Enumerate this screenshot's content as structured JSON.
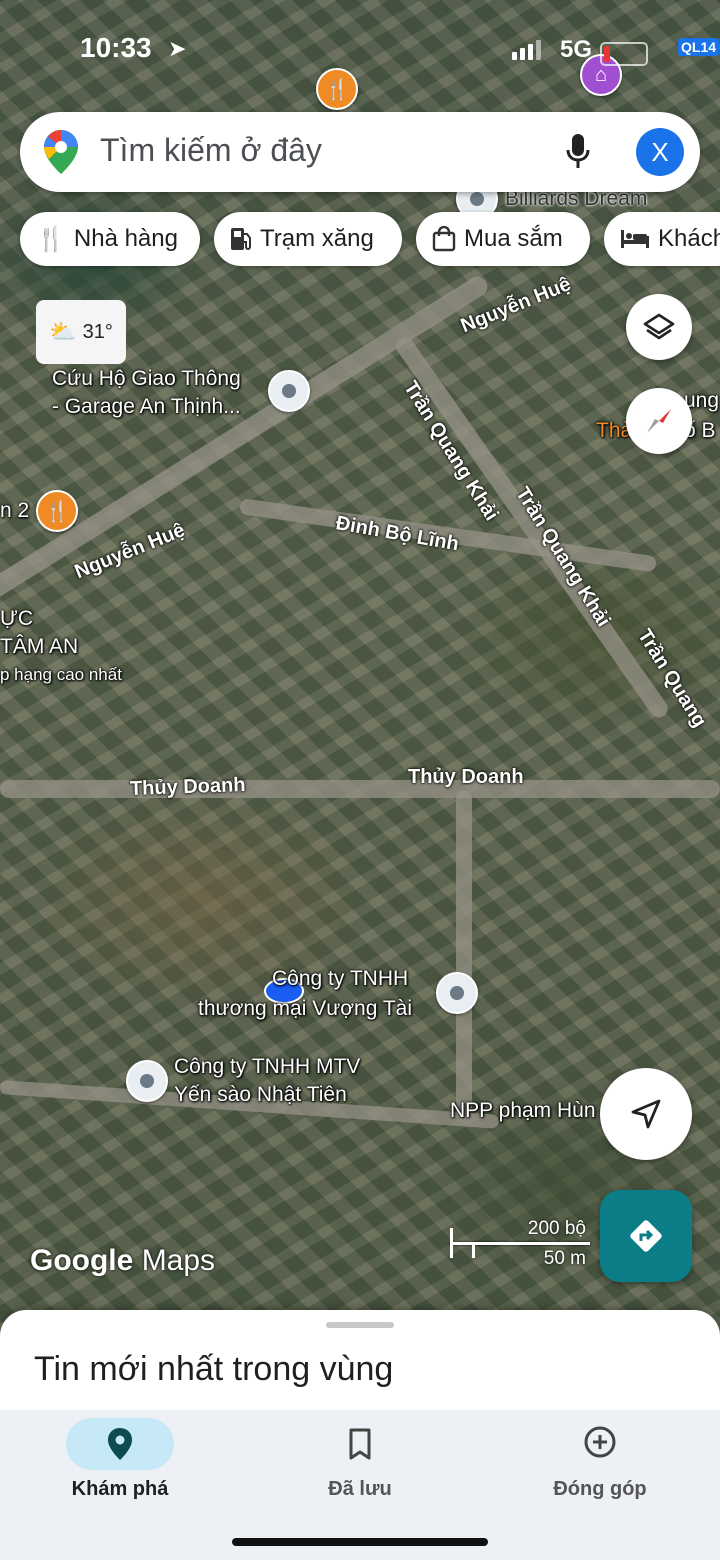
{
  "status_bar": {
    "time": "10:33",
    "network": "5G",
    "route_badge": "QL14"
  },
  "search": {
    "placeholder": "Tìm kiếm ở đây",
    "avatar_letter": "X"
  },
  "chips": [
    {
      "label": "Nhà hàng",
      "icon": "restaurant-icon"
    },
    {
      "label": "Trạm xăng",
      "icon": "gas-station-icon"
    },
    {
      "label": "Mua sắm",
      "icon": "shopping-bag-icon"
    },
    {
      "label": "Khách",
      "icon": "hotel-bed-icon"
    }
  ],
  "weather": {
    "temp": "31°",
    "icon": "partly-cloudy-icon"
  },
  "map": {
    "roads": {
      "nguyen_hue_1": "Nguyễn Huệ",
      "nguyen_hue_2": "Nguyễn Huệ",
      "tran_quang_khai_1": "Trần Quang Khải",
      "tran_quang_khai_2": "Trần Quang Khải",
      "tran_quang_3": "Trần Quang",
      "dinh_bo_linh": "Đinh Bộ Lĩnh",
      "thuy_doanh_1": "Thủy Doanh",
      "thuy_doanh_2": "Thủy Doanh"
    },
    "places": {
      "billiards": "Billiards Dream",
      "garage_line1": "Cứu Hộ Giao Thông",
      "garage_line2": "- Garage An Thịnh...",
      "left_edge_1": "n 2",
      "tam_an_line1": "ỰC",
      "tam_an_line2": "TÂM AN",
      "tam_an_line3": "p hạng cao nhất",
      "right_edge_1": "ung",
      "right_edge_2": "Thà",
      "right_edge_3": "ố B",
      "vuong_tai_line1": "Công ty TNHH",
      "vuong_tai_line2": "thương mại Vượng Tài",
      "nhat_tien_line1": "Công ty TNHH MTV",
      "nhat_tien_line2": "Yến sào Nhật Tiên",
      "npp": "NPP phạm Hùn"
    },
    "scale": {
      "imperial": "200 bộ",
      "metric": "50 m"
    },
    "logo": {
      "google": "Google",
      "maps": "Maps"
    }
  },
  "sheet": {
    "title": "Tin mới nhất trong vùng"
  },
  "nav": [
    {
      "label": "Khám phá",
      "icon": "explore-pin-icon",
      "active": true
    },
    {
      "label": "Đã lưu",
      "icon": "bookmark-icon",
      "active": false
    },
    {
      "label": "Đóng góp",
      "icon": "add-circle-icon",
      "active": false
    }
  ],
  "colors": {
    "accent": "#0b7d87",
    "nav_active": "#c7e8f7",
    "avatar": "#1a73e8",
    "food_pin": "#f08a24"
  }
}
